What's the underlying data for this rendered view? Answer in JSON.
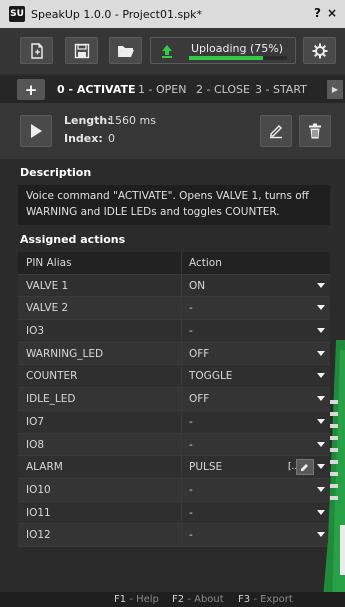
{
  "window": {
    "app_icon": "SU-app-icon",
    "title": "SpeakUp 1.0.0 - Project01.spk*",
    "help_label": "?",
    "close_label": "×"
  },
  "toolbar": {
    "new_icon": "new-file-icon",
    "save_icon": "save-icon",
    "open_icon": "open-folder-icon",
    "upload_icon": "upload-arrow-icon",
    "upload_label": "Uploading (75%)",
    "upload_progress": 0.75,
    "settings_icon": "gear-icon",
    "accent_green": "#35c94a"
  },
  "tabs": {
    "add_label": "+",
    "items": [
      {
        "label": "0 - ACTIVATE",
        "active": true
      },
      {
        "label": "1 - OPEN",
        "active": false
      },
      {
        "label": "2 - CLOSE",
        "active": false
      },
      {
        "label": "3 - START",
        "active": false
      }
    ],
    "scroll_icon": "chevron-right-icon"
  },
  "command": {
    "play_icon": "play-icon",
    "length_key": "Length:",
    "length_value": "1560 ms",
    "index_key": "Index:",
    "index_value": "0",
    "edit_icon": "pencil-icon",
    "delete_icon": "trash-icon"
  },
  "description": {
    "heading": "Description",
    "line1": "Voice command \"ACTIVATE\". Opens VALVE 1, turns off",
    "line2": "WARNING and IDLE LEDs and toggles COUNTER."
  },
  "actions": {
    "heading": "Assigned actions",
    "col_alias": "PIN Alias",
    "col_action": "Action",
    "rows": [
      {
        "alias": "VALVE 1",
        "action": "ON"
      },
      {
        "alias": "VALVE 2",
        "action": "-"
      },
      {
        "alias": "IO3",
        "action": "-"
      },
      {
        "alias": "WARNING_LED",
        "action": "OFF"
      },
      {
        "alias": "COUNTER",
        "action": "TOGGLE"
      },
      {
        "alias": "IDLE_LED",
        "action": "OFF"
      },
      {
        "alias": "IO7",
        "action": "-"
      },
      {
        "alias": "IO8",
        "action": "-"
      },
      {
        "alias": "ALARM",
        "action": "PULSE",
        "extra": "[...]"
      },
      {
        "alias": "IO10",
        "action": "-"
      },
      {
        "alias": "IO11",
        "action": "-"
      },
      {
        "alias": "IO12",
        "action": "-"
      }
    ]
  },
  "footer": {
    "f1_key": "F1",
    "f1_label": "- Help",
    "f2_key": "F2",
    "f2_label": "- About",
    "f3_key": "F3",
    "f3_label": "- Export"
  }
}
